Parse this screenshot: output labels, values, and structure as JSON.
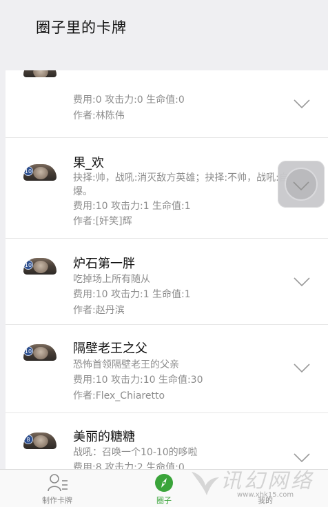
{
  "header": {
    "title": "圈子里的卡牌"
  },
  "cards": [
    {
      "gem": "",
      "name": "",
      "desc": "",
      "stats": "费用:0  攻击力:0  生命值:0",
      "author": "作者:林陈伟"
    },
    {
      "gem": "10",
      "name": "果_欢",
      "desc": "抉择:帅，战吼:消灭敌方英雄；抉择:不帅，战吼:自爆。",
      "stats": "费用:10  攻击力:1  生命值:1",
      "author": "作者:[奸笑]辉"
    },
    {
      "gem": "10",
      "name": "炉石第一胖",
      "desc": "吃掉场上所有随从",
      "stats": "费用:10  攻击力:1  生命值:1",
      "author": "作者:赵丹滨"
    },
    {
      "gem": "10",
      "name": "隔壁老王之父",
      "desc": "恐怖首领隔壁老王的父亲",
      "stats": "费用:10  攻击力:10  生命值:30",
      "author": "作者:Flex_Chiaretto"
    },
    {
      "gem": "8",
      "name": "美丽的糖糖",
      "desc": "战吼：召唤一个10-10的哆啦",
      "stats": "费用:8  攻击力:2  生命值:0",
      "author": ""
    }
  ],
  "tabbar": {
    "make_label": "制作卡牌",
    "circle_label": "圈子",
    "mine_label": "我的"
  },
  "watermark": {
    "text": "讯幻网络",
    "url": "www.xhk15.com"
  },
  "colors": {
    "accent": "#3aa43a",
    "muted": "#8c8c8c"
  }
}
